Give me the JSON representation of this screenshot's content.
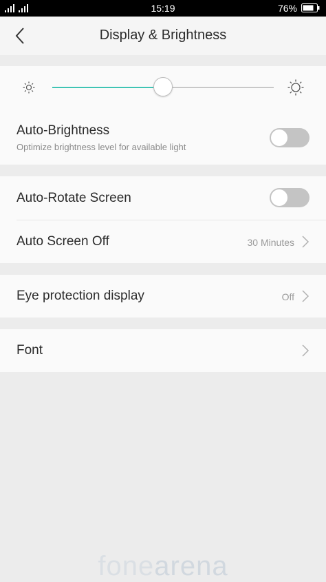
{
  "status_bar": {
    "time": "15:19",
    "battery_percent": "76%",
    "signal_icon": "signal-bars-icon",
    "battery_icon": "battery-icon"
  },
  "header": {
    "back_icon": "back-arrow-icon",
    "title": "Display & Brightness"
  },
  "brightness": {
    "level_fraction": 0.5,
    "min_icon": "sun-small-icon",
    "max_icon": "sun-large-icon",
    "accent_color": "#3fc4b4"
  },
  "auto_brightness": {
    "label": "Auto-Brightness",
    "description": "Optimize brightness level for available light",
    "enabled": false
  },
  "auto_rotate": {
    "label": "Auto-Rotate Screen",
    "enabled": false
  },
  "auto_screen_off": {
    "label": "Auto Screen Off",
    "value": "30 Minutes"
  },
  "eye_protection": {
    "label": "Eye protection display",
    "value": "Off"
  },
  "font": {
    "label": "Font"
  },
  "watermark": {
    "part1": "fone",
    "part2": "arena"
  }
}
